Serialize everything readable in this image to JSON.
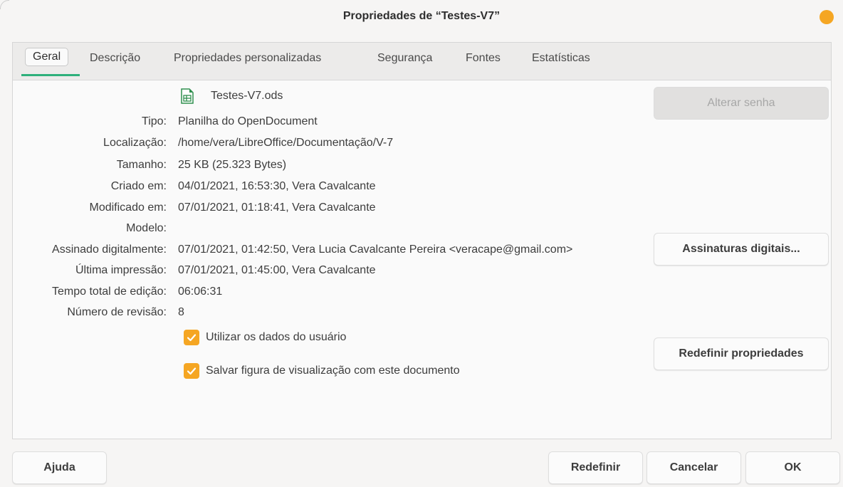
{
  "window": {
    "title": "Propriedades de “Testes-V7”"
  },
  "tabs": [
    {
      "label": "Geral"
    },
    {
      "label": "Descrição"
    },
    {
      "label": "Propriedades personalizadas"
    },
    {
      "label": "Segurança"
    },
    {
      "label": "Fontes"
    },
    {
      "label": "Estatísticas"
    }
  ],
  "file": {
    "name": "Testes-V7.ods",
    "icon": "spreadsheet-file-icon"
  },
  "properties": [
    {
      "label": "Tipo:",
      "value": "Planilha do OpenDocument"
    },
    {
      "label": "Localização:",
      "value": "/home/vera/LibreOffice/Documentação/V-7"
    },
    {
      "label": "Tamanho:",
      "value": "25 KB (25.323 Bytes)"
    },
    {
      "label": "Criado em:",
      "value": "04/01/2021, 16:53:30, Vera Cavalcante"
    },
    {
      "label": "Modificado em:",
      "value": "07/01/2021, 01:18:41, Vera Cavalcante"
    },
    {
      "label": "Modelo:",
      "value": ""
    },
    {
      "label": "Assinado digitalmente:",
      "value": "07/01/2021, 01:42:50, Vera Lucia Cavalcante Pereira <veracape@gmail.com>"
    },
    {
      "label": "Última impressão:",
      "value": "07/01/2021, 01:45:00, Vera Cavalcante"
    },
    {
      "label": "Tempo total de edição:",
      "value": "06:06:31"
    },
    {
      "label": "Número de revisão:",
      "value": "8"
    }
  ],
  "checkboxes": [
    {
      "label": "Utilizar os dados do usuário",
      "checked": true
    },
    {
      "label": "Salvar figura de visualização com este documento",
      "checked": true
    }
  ],
  "side_buttons": {
    "change_password": "Alterar senha",
    "digital_signatures": "Assinaturas digitais...",
    "reset_properties": "Redefinir propriedades"
  },
  "footer": {
    "help": "Ajuda",
    "reset": "Redefinir",
    "cancel": "Cancelar",
    "ok": "OK"
  },
  "colors": {
    "accent_check": "#f5a623",
    "tab_underline": "#2fb07b",
    "window_dot": "#f5a623"
  }
}
